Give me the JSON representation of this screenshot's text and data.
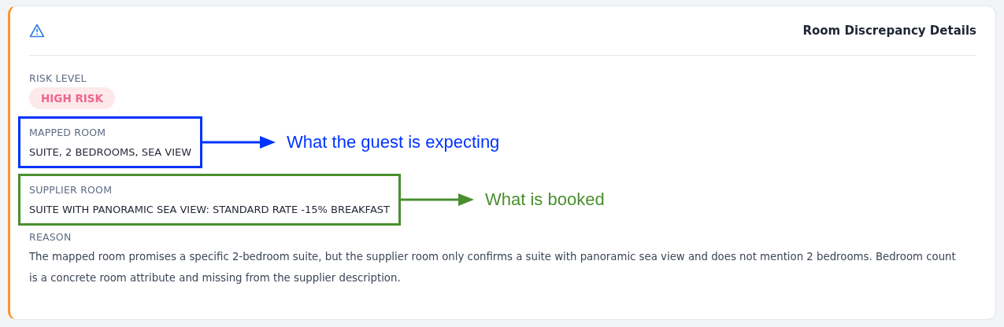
{
  "card": {
    "title": "Room Discrepancy Details"
  },
  "sections": [
    {
      "kind": "badge",
      "label": "RISK LEVEL",
      "value": "HIGH RISK"
    },
    {
      "kind": "annotated",
      "label": "MAPPED ROOM",
      "value": "SUITE, 2 BEDROOMS, SEA VIEW",
      "annotation": {
        "text": "What the guest is expecting",
        "color": "#0033ff"
      }
    },
    {
      "kind": "annotated",
      "label": "SUPPLIER ROOM",
      "value": "SUITE WITH PANORAMIC SEA VIEW: STANDARD RATE -15% BREAKFAST",
      "annotation": {
        "text": "What is booked",
        "color": "#4a8f2e"
      }
    },
    {
      "kind": "text",
      "label": "REASON",
      "value": "The mapped room promises a specific 2-bedroom suite, but the supplier room only confirms a suite with panoramic sea view and does not mention 2 bedrooms. Bedroom count is a concrete room attribute and missing from the supplier description."
    }
  ]
}
